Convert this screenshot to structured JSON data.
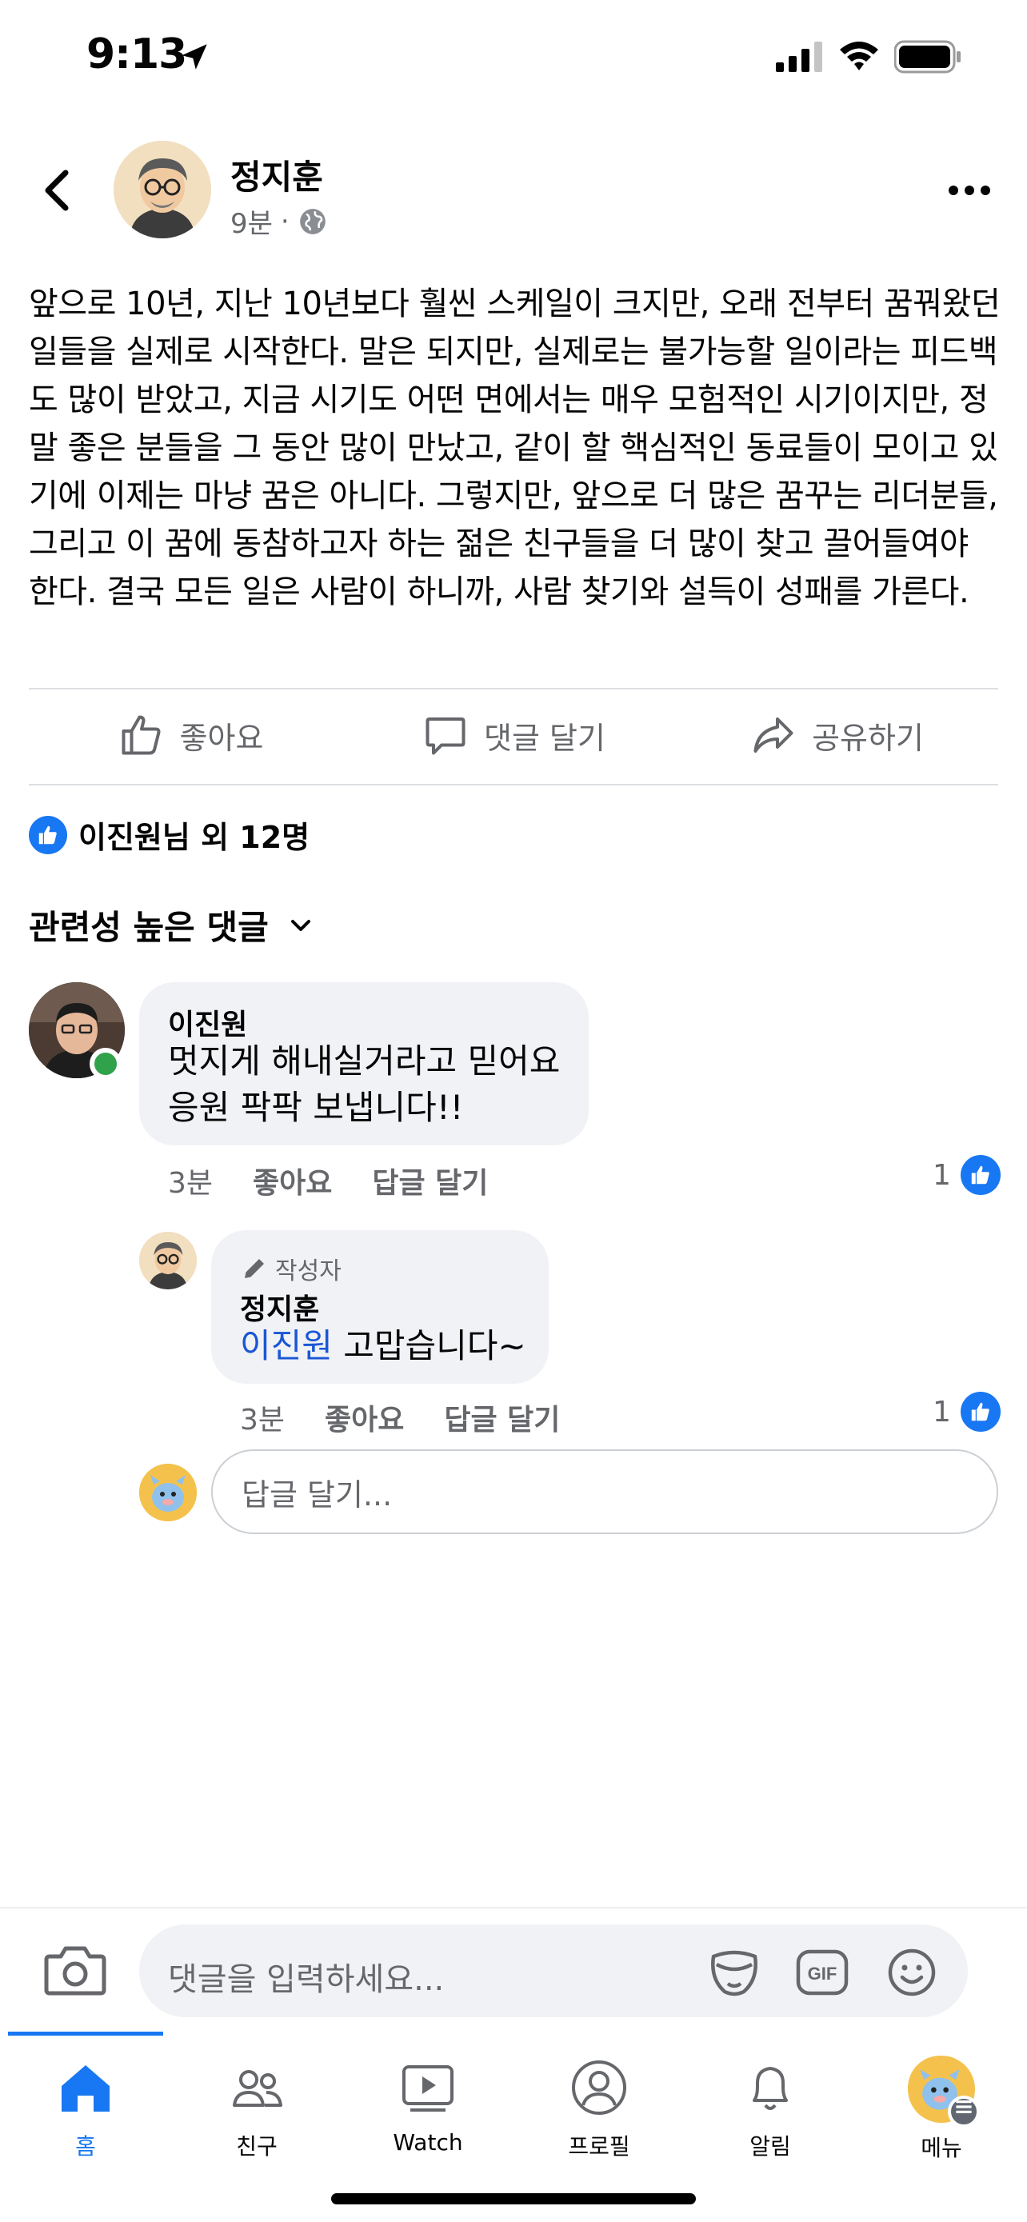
{
  "status_bar": {
    "time": "9:13"
  },
  "post": {
    "author": "정지훈",
    "time": "9분",
    "separator": "·",
    "text": "앞으로 10년, 지난 10년보다 훨씬 스케일이 크지만, 오래 전부터 꿈꿔왔던 일들을 실제로 시작한다. 말은 되지만, 실제로는 불가능할 일이라는 피드백도 많이 받았고, 지금 시기도 어떤 면에서는 매우 모험적인 시기이지만, 정말 좋은 분들을 그 동안 많이 만났고, 같이 할 핵심적인 동료들이 모이고 있기에 이제는 마냥 꿈은 아니다. 그렇지만, 앞으로 더 많은 꿈꾸는 리더분들, 그리고 이 꿈에 동참하고자 하는 젊은 친구들을 더 많이 찾고 끌어들여야 한다. 결국 모든 일은 사람이 하니까, 사람 찾기와 설득이 성패를 가른다."
  },
  "actions": {
    "like": "좋아요",
    "comment": "댓글 달기",
    "share": "공유하기"
  },
  "reactions": {
    "summary": "이진원님 외 12명"
  },
  "comments_sort": {
    "label": "관련성 높은 댓글"
  },
  "comments": [
    {
      "name": "이진원",
      "text": "멋지게 해내실거라고 믿어요\n응원 팍팍 보냅니다!!",
      "time": "3분",
      "like_action": "좋아요",
      "reply_action": "답글 달기",
      "like_count": "1"
    }
  ],
  "reply": {
    "badge": "작성자",
    "name": "정지훈",
    "mention": "이진원",
    "text": " 고맙습니다~",
    "time": "3분",
    "like_action": "좋아요",
    "reply_action": "답글 달기",
    "like_count": "1"
  },
  "reply_input": {
    "placeholder": "답글 달기..."
  },
  "composer": {
    "placeholder": "댓글을 입력하세요..."
  },
  "tabs": [
    {
      "label": "홈",
      "icon": "home-icon",
      "active": true
    },
    {
      "label": "친구",
      "icon": "friends-icon"
    },
    {
      "label": "Watch",
      "icon": "watch-icon"
    },
    {
      "label": "프로필",
      "icon": "profile-icon"
    },
    {
      "label": "알림",
      "icon": "bell-icon"
    },
    {
      "label": "메뉴",
      "icon": "menu-avatar-icon"
    }
  ],
  "colors": {
    "accent": "#1877f2",
    "secondary_text": "#65676b",
    "bubble": "#f0f2f5",
    "online": "#31a24c"
  }
}
